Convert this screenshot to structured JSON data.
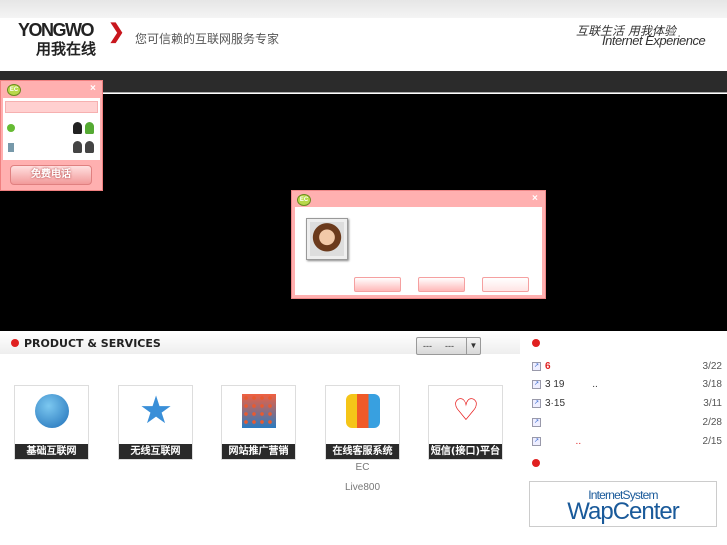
{
  "header": {
    "logo_en": "YONGWO",
    "logo_cn": "用我在线",
    "slogan": "您可信赖的互联网服务专家",
    "tagline_cn": "互联生活 用我体验",
    "tagline_en": "Internet Experience"
  },
  "widget": {
    "close": "×",
    "call_label": "免费电话"
  },
  "dialog": {
    "close": "×"
  },
  "products": {
    "title": "PRODUCT & SERVICES",
    "select_a": "---",
    "select_b": "---",
    "items": [
      {
        "label": "基础互联网"
      },
      {
        "label": "无线互联网"
      },
      {
        "label": "网站推广营销"
      },
      {
        "label": "在线客服系统"
      },
      {
        "label": "短信(接口)平台"
      }
    ],
    "sub1": "EC",
    "sub2": "Live800"
  },
  "news": [
    {
      "title": "6",
      "date": "3/22",
      "red": true
    },
    {
      "title": "3 19          ..",
      "date": "3/18"
    },
    {
      "title": "3·15",
      "date": "3/11"
    },
    {
      "title": "",
      "date": "2/28"
    },
    {
      "title": "           ..",
      "date": "2/15"
    }
  ],
  "wap": {
    "line1": "InternetSystem",
    "line2": "WapCenter"
  },
  "colors": {
    "accent": "#e02020",
    "dialog": "#ffb0b0"
  }
}
